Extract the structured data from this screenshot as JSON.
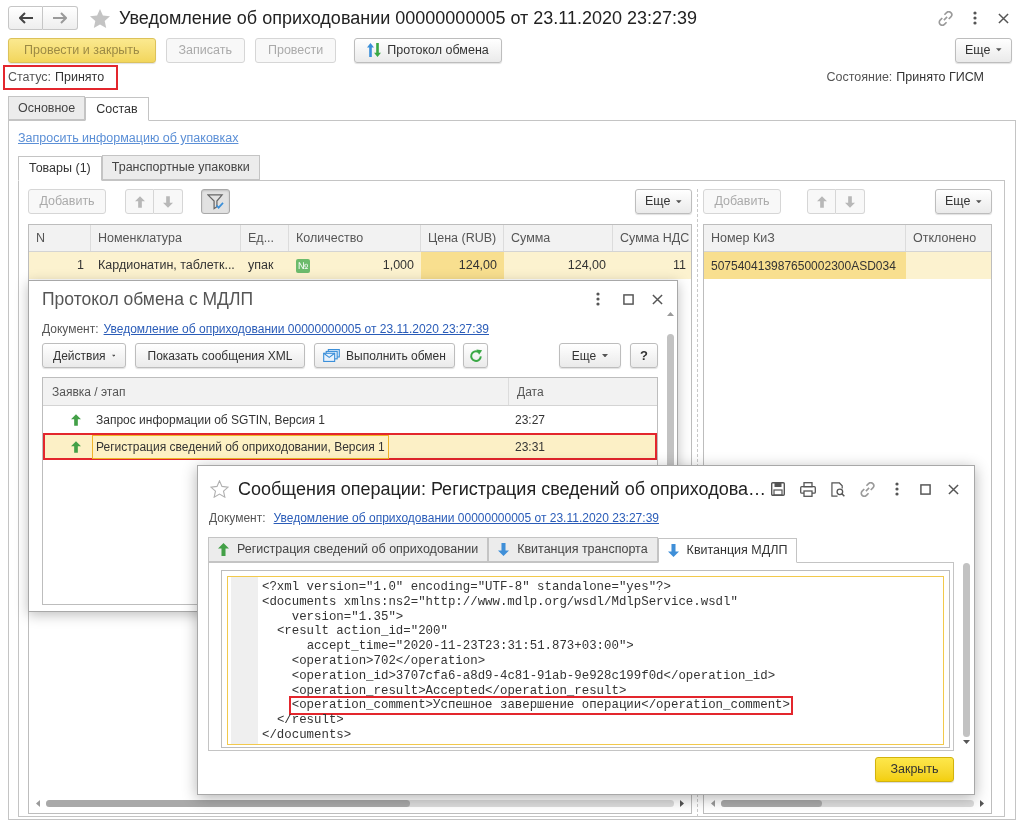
{
  "window": {
    "title": "Уведомление об оприходовании 00000000005 от 23.11.2020 23:27:39"
  },
  "command_bar": {
    "buttons": [
      {
        "label": "Провести и закрыть",
        "kind": "default",
        "disabled": false
      },
      {
        "label": "Записать",
        "kind": "plain",
        "disabled": true
      },
      {
        "label": "Провести",
        "kind": "plain",
        "disabled": true
      },
      {
        "label": "Протокол обмена",
        "kind": "exchange",
        "disabled": false
      }
    ],
    "more": "Еще"
  },
  "status": {
    "label": "Статус:",
    "value": "Принято",
    "highlighted": true
  },
  "state": {
    "label": "Состояние:",
    "value": "Принято ГИСМ"
  },
  "tabs": [
    {
      "label": "Основное",
      "selected": false
    },
    {
      "label": "Состав",
      "selected": true
    }
  ],
  "request_link": "Запросить информацию об упаковках",
  "inner_tabs": [
    {
      "label": "Товары (1)",
      "selected": true
    },
    {
      "label": "Транспортные упаковки",
      "selected": false
    }
  ],
  "goods_table": {
    "add_button": {
      "label": "Добавить",
      "disabled": true
    },
    "filter_pressed": true,
    "more_button": "Еще",
    "columns": [
      {
        "label": "N",
        "kind": "number"
      },
      {
        "label": "Номенклатура",
        "kind": "text"
      },
      {
        "label": "Ед...",
        "kind": "text"
      },
      {
        "label": "Количество",
        "kind": "number"
      },
      {
        "label": "Цена (RUB)",
        "kind": "number"
      },
      {
        "label": "Сумма",
        "kind": "number"
      },
      {
        "label": "Сумма НДС",
        "kind": "number"
      }
    ],
    "rows": [
      {
        "selected": true,
        "cells": [
          {
            "text": "1",
            "focused": false
          },
          {
            "text": "Кардионатин, таблетк...",
            "focused": false
          },
          {
            "text": "упак",
            "focused": false
          },
          {
            "text": "1,000",
            "focused": false,
            "badge": "№"
          },
          {
            "text": "124,00",
            "focused": true
          },
          {
            "text": "124,00",
            "focused": false
          },
          {
            "text": "11",
            "focused": false
          }
        ]
      }
    ]
  },
  "codes_table": {
    "add_button": {
      "label": "Добавить",
      "disabled": true
    },
    "more_button": "Еще",
    "columns": [
      {
        "label": "Номер КиЗ"
      },
      {
        "label": "Отклонено"
      }
    ],
    "rows": [
      {
        "selected": true,
        "cells": [
          {
            "text": "507540413987650002300ASD034",
            "focused": true
          }
        ]
      }
    ]
  },
  "protocol_window": {
    "title": "Протокол обмена с МДЛП",
    "document_label": "Документ:",
    "document_link": "Уведомление об оприходовании 00000000005 от 23.11.2020 23:27:39",
    "buttons": [
      {
        "label": "Действия",
        "kind": "dropdown"
      },
      {
        "label": "Показать сообщения XML",
        "kind": "plain"
      },
      {
        "label": "Выполнить обмен",
        "kind": "exchange"
      },
      {
        "kind": "refresh"
      }
    ],
    "more_button": "Еще",
    "help_button": "?",
    "columns": [
      "Заявка / этап",
      "Дата"
    ],
    "rows": [
      {
        "stage": "Запрос информации об SGTIN, Версия 1",
        "date": "23:27",
        "kind": "outgoing",
        "selected": false,
        "highlighted": false
      },
      {
        "stage": "Регистрация сведений об оприходовании, Версия 1",
        "date": "23:31",
        "kind": "outgoing",
        "selected": true,
        "highlighted": true
      }
    ]
  },
  "messages_window": {
    "title": "Сообщения операции: Регистрация сведений об оприходова…",
    "document_label": "Документ:",
    "document_link": "Уведомление об оприходовании 00000000005 от 23.11.2020 23:27:39",
    "tabs": [
      {
        "label": "Регистрация сведений об оприходовании",
        "kind": "outgoing",
        "selected": false
      },
      {
        "label": "Квитанция транспорта",
        "kind": "incoming",
        "selected": false
      },
      {
        "label": "Квитанция МДЛП",
        "kind": "incoming",
        "selected": true
      }
    ],
    "xml_lines": [
      {
        "text": "<?xml version=\"1.0\" encoding=\"UTF-8\" standalone=\"yes\"?>",
        "highlighted": false
      },
      {
        "text": "<documents xmlns:ns2=\"http://www.mdlp.org/wsdl/MdlpService.wsdl\"",
        "highlighted": false
      },
      {
        "text": "    version=\"1.35\">",
        "highlighted": false
      },
      {
        "text": "  <result action_id=\"200\"",
        "highlighted": false
      },
      {
        "text": "      accept_time=\"2020-11-23T23:31:51.873+03:00\">",
        "highlighted": false
      },
      {
        "text": "    <operation>702</operation>",
        "highlighted": false
      },
      {
        "text": "    <operation_id>3707cfa6-a8d9-4c81-91ab-9e928c199f0d</operation_id>",
        "highlighted": false
      },
      {
        "text": "    <operation_result>Accepted</operation_result>",
        "highlighted": false
      },
      {
        "text": "    <operation_comment>Успешное завершение операции</operation_comment>",
        "highlighted": true
      },
      {
        "text": "  </result>",
        "highlighted": false
      },
      {
        "text": "</documents>",
        "highlighted": false
      }
    ],
    "close_button": "Закрыть"
  }
}
